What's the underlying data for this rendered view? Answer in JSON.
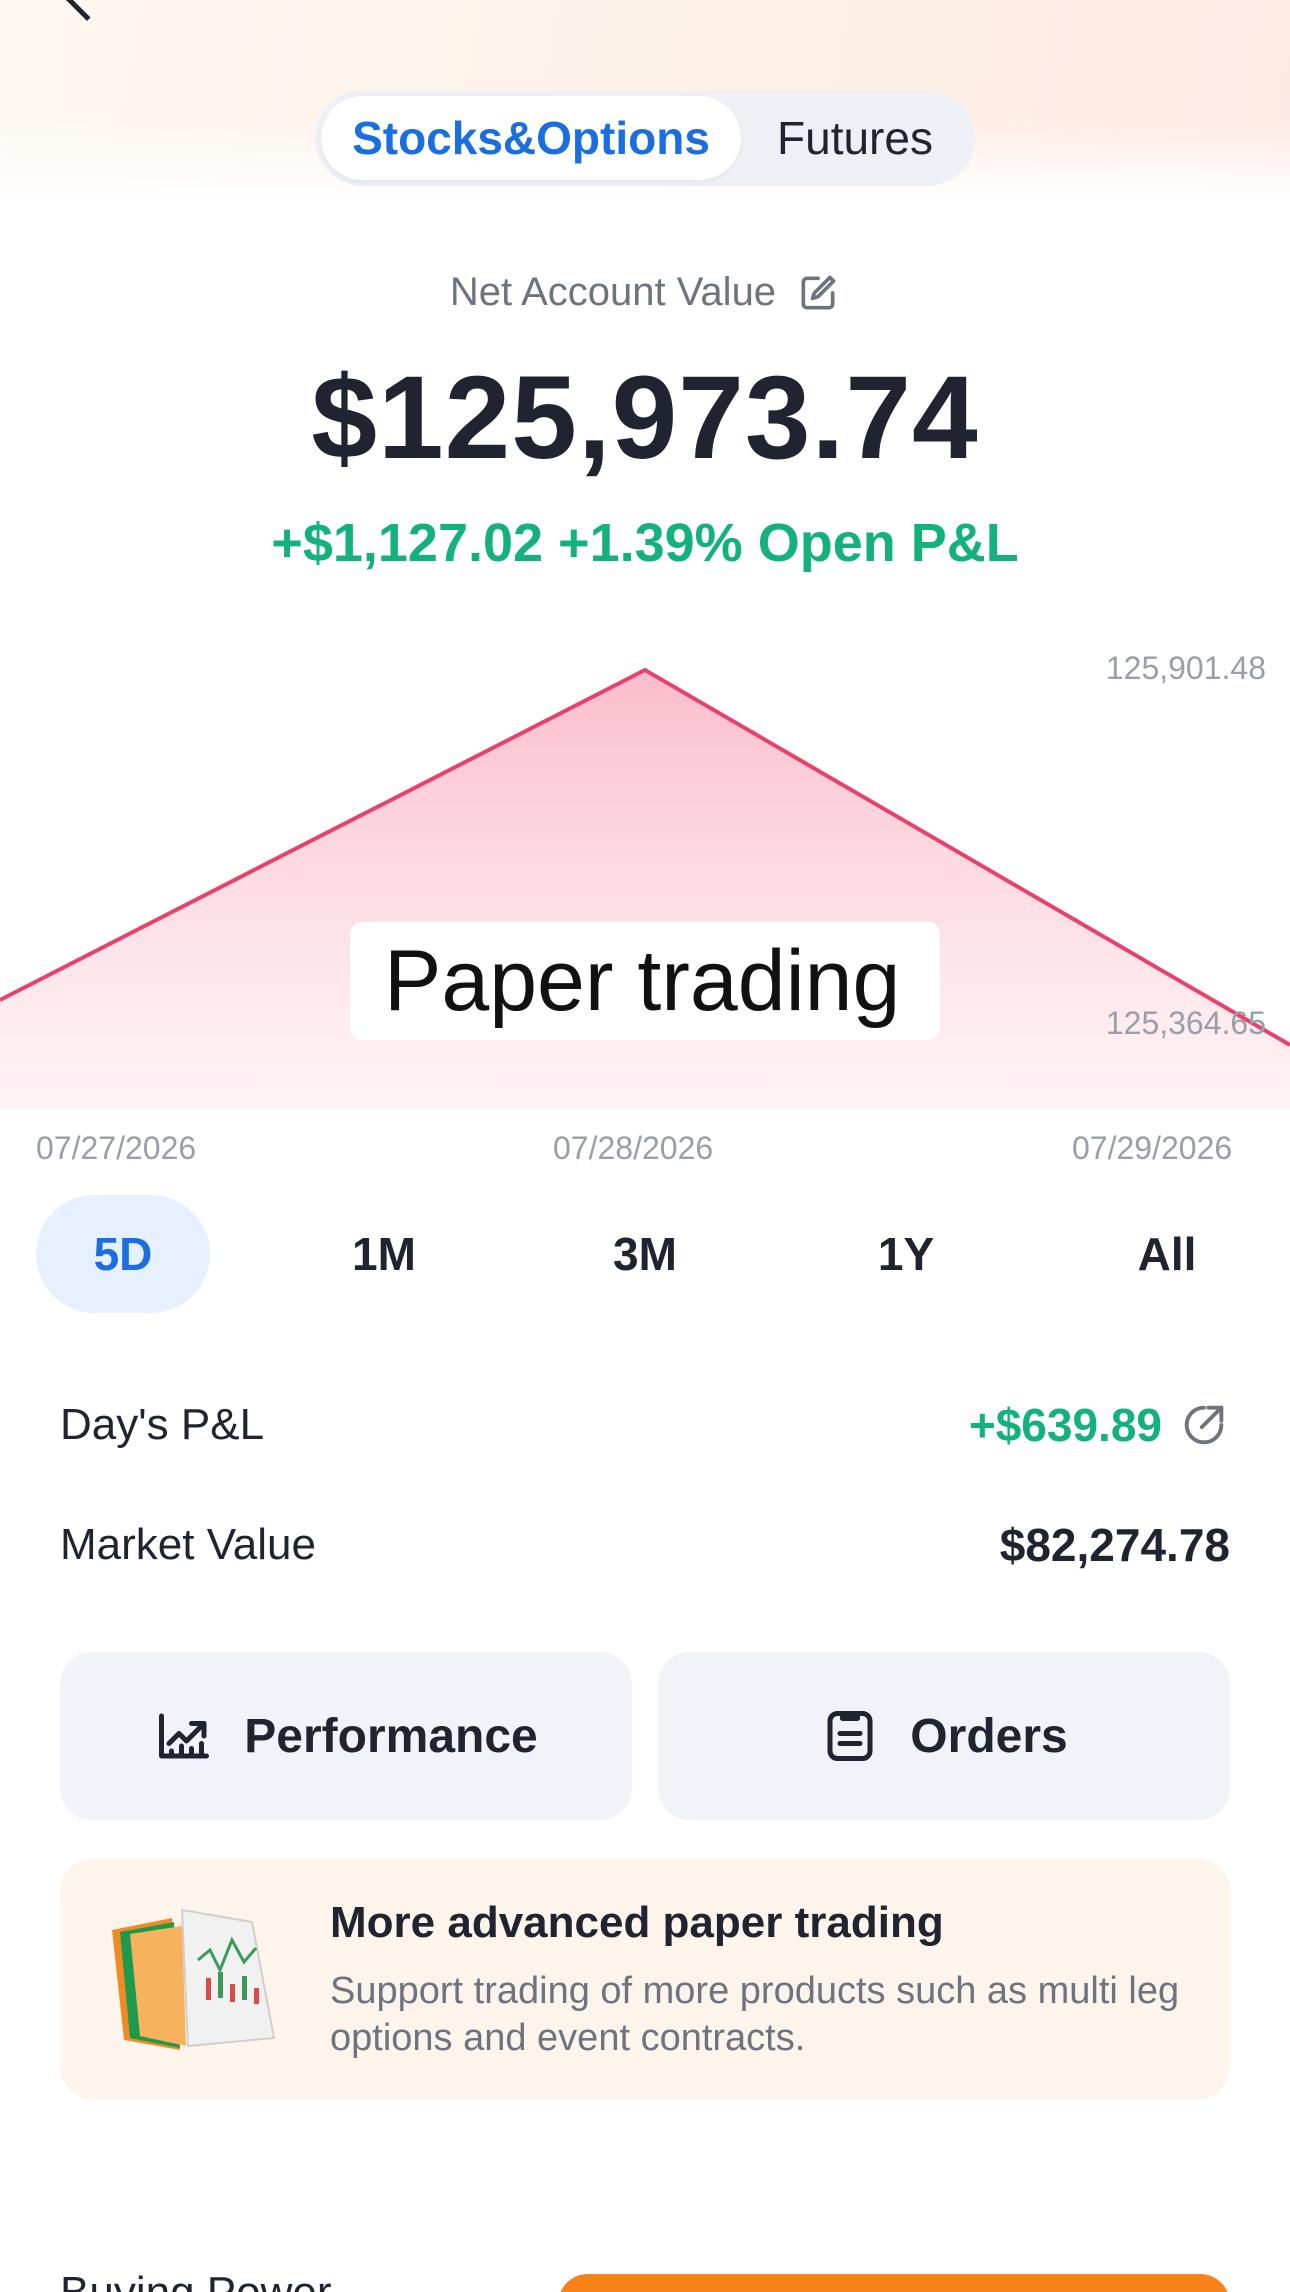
{
  "segment": {
    "tabs": [
      {
        "label": "Stocks&Options",
        "active": true
      },
      {
        "label": "Futures",
        "active": false
      }
    ]
  },
  "account": {
    "label": "Net Account Value",
    "value": "$125,973.74",
    "open_pl": "+$1,127.02 +1.39% Open P&L"
  },
  "chart_data": {
    "type": "area",
    "x": [
      "07/27/2026",
      "07/28/2026",
      "07/29/2026"
    ],
    "y": [
      125364.65,
      125901.48,
      125364.65
    ],
    "y_tick_labels": [
      "125,901.48",
      "125,364.65"
    ],
    "x_tick_labels": [
      "07/27/2026",
      "07/28/2026",
      "07/29/2026"
    ],
    "ylim": [
      125364.65,
      125901.48
    ],
    "line_color": "#e8426c",
    "fill_color": "#fbc3d0",
    "grid": false
  },
  "watermark": "Paper trading",
  "ranges": [
    {
      "label": "5D",
      "active": true
    },
    {
      "label": "1M",
      "active": false
    },
    {
      "label": "3M",
      "active": false
    },
    {
      "label": "1Y",
      "active": false
    },
    {
      "label": "All",
      "active": false
    }
  ],
  "stats": {
    "days_pl_label": "Day's P&L",
    "days_pl_value": "+$639.89",
    "market_value_label": "Market Value",
    "market_value_value": "$82,274.78"
  },
  "actions": {
    "performance_label": "Performance",
    "orders_label": "Orders"
  },
  "promo": {
    "title": "More advanced paper trading",
    "description": "Support trading of more products such as multi leg options and event contracts."
  },
  "bottom": {
    "buying_power_label": "Buying Power"
  },
  "colors": {
    "accent": "#1a6ee0",
    "positive": "#13b17c",
    "orange": "#f7821a"
  }
}
